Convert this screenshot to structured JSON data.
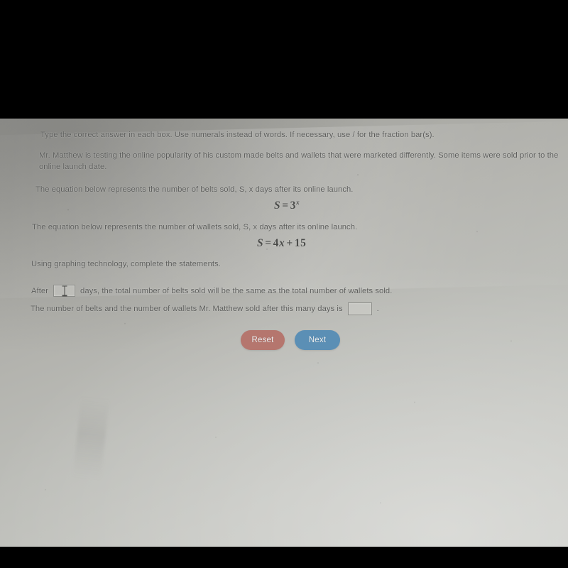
{
  "photo": {
    "background_top_band_color": "#000000",
    "screen_gradient_dark": "#9a9a96",
    "screen_gradient_light": "#c9cac5"
  },
  "worksheet": {
    "instruction": "Type the correct answer in each box. Use numerals instead of words. If necessary, use / for the fraction bar(s).",
    "problem_intro": "Mr. Matthew is testing the online popularity of his custom made belts and wallets that were marketed differently. Some items were sold prior to the online launch date.",
    "belts_sentence": "The equation below represents the number of belts sold, S, x days after its online launch.",
    "wallets_sentence": "The equation below represents the number of wallets sold, S, x days after its online launch.",
    "graphing_sentence": "Using graphing technology, complete the statements.",
    "equations": {
      "belts": {
        "lhs": "S",
        "operator": "=",
        "base": "3",
        "exponent": "x",
        "plain": "S = 3^x"
      },
      "wallets": {
        "lhs": "S",
        "operator": "=",
        "coefficient": "4",
        "variable": "x",
        "plus": "+",
        "constant": "15",
        "plain": "S = 4x + 15"
      }
    },
    "statements": {
      "days": {
        "prefix": "After",
        "answer_value": "",
        "suffix": "days, the total number of belts sold will be the same as the total number of wallets sold."
      },
      "total": {
        "prefix": "The number of belts and the number of wallets Mr. Matthew sold after this many days is",
        "answer_value": "",
        "suffix": "."
      }
    }
  },
  "buttons": {
    "reset": {
      "label": "Reset",
      "color": "#b5766e"
    },
    "next": {
      "label": "Next",
      "color": "#5b8fb5"
    }
  }
}
